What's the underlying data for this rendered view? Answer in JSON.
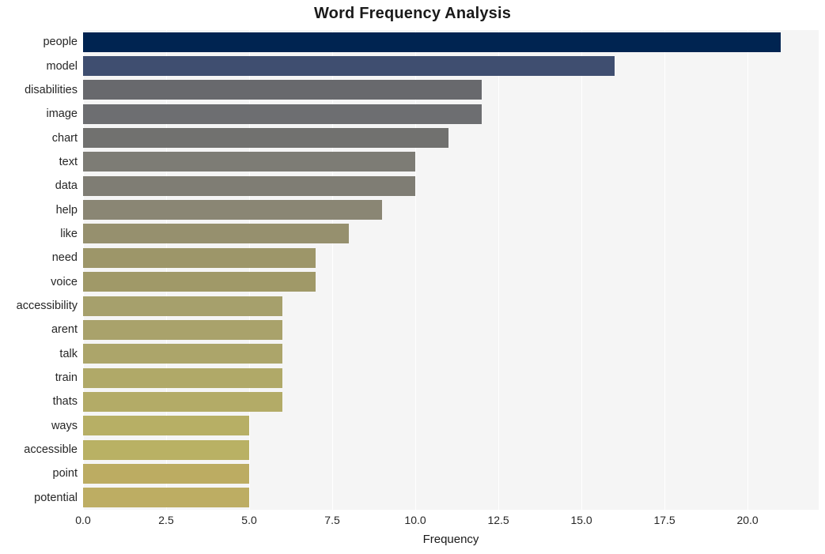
{
  "chart_data": {
    "type": "bar",
    "orientation": "horizontal",
    "title": "Word Frequency Analysis",
    "xlabel": "Frequency",
    "ylabel": "",
    "xlim": [
      0,
      22.14
    ],
    "xticks": [
      "0.0",
      "2.5",
      "5.0",
      "7.5",
      "10.0",
      "12.5",
      "15.0",
      "17.5",
      "20.0"
    ],
    "xtick_values": [
      0,
      2.5,
      5,
      7.5,
      10,
      12.5,
      15,
      17.5,
      20
    ],
    "grid": "vertical-white-on-light-gray",
    "legend": "none",
    "categories": [
      "people",
      "model",
      "disabilities",
      "image",
      "chart",
      "text",
      "data",
      "help",
      "like",
      "need",
      "voice",
      "accessibility",
      "arent",
      "talk",
      "train",
      "thats",
      "ways",
      "accessible",
      "point",
      "potential"
    ],
    "values": [
      21,
      16,
      12,
      12,
      11,
      10,
      10,
      9,
      8,
      7,
      7,
      6,
      6,
      6,
      6,
      6,
      5,
      5,
      5,
      5
    ],
    "bar_colors": [
      "#002451",
      "#3f4e70",
      "#68696d",
      "#6d6e71",
      "#71716f",
      "#7d7c75",
      "#7f7d74",
      "#8a8674",
      "#96906e",
      "#9d9669",
      "#a09968",
      "#a6a06c",
      "#a9a26b",
      "#aca56a",
      "#b0a968",
      "#b3ab67",
      "#b7af65",
      "#b9b164",
      "#bcac62",
      "#bdad63"
    ],
    "plot_background": "#f5f5f5",
    "gridline_color": "#ffffff",
    "page_background": "#ffffff"
  }
}
